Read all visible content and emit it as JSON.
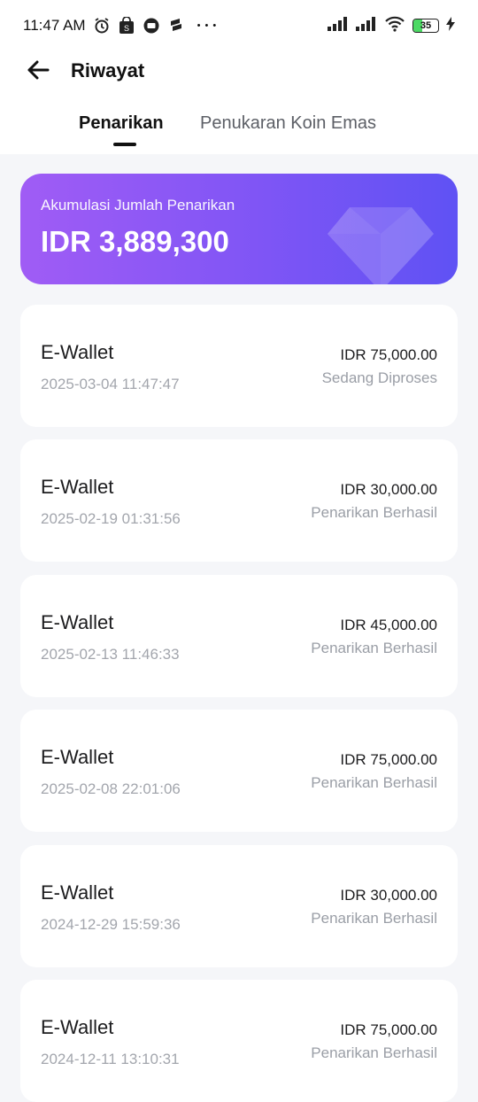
{
  "status_bar": {
    "time": "11:47 AM",
    "icons_left": [
      "alarm-icon",
      "shop-icon",
      "message-icon",
      "app-icon",
      "more-icon"
    ],
    "more_text": "• • •",
    "battery": "35",
    "icons_right": [
      "signal-icon",
      "signal-icon",
      "wifi-icon",
      "battery-icon",
      "charging-icon"
    ]
  },
  "header": {
    "title": "Riwayat",
    "back_icon": "arrow-left-icon"
  },
  "tabs": [
    {
      "label": "Penarikan",
      "active": true
    },
    {
      "label": "Penukaran Koin Emas",
      "active": false
    }
  ],
  "summary": {
    "label": "Akumulasi Jumlah Penarikan",
    "value": "IDR 3,889,300",
    "gradient_start": "#a05cf5",
    "gradient_end": "#5f52f4"
  },
  "transactions": [
    {
      "method": "E-Wallet",
      "date": "2025-03-04 11:47:47",
      "amount": "IDR 75,000.00",
      "status": "Sedang Diproses"
    },
    {
      "method": "E-Wallet",
      "date": "2025-02-19 01:31:56",
      "amount": "IDR 30,000.00",
      "status": "Penarikan Berhasil"
    },
    {
      "method": "E-Wallet",
      "date": "2025-02-13 11:46:33",
      "amount": "IDR 45,000.00",
      "status": "Penarikan Berhasil"
    },
    {
      "method": "E-Wallet",
      "date": "2025-02-08 22:01:06",
      "amount": "IDR 75,000.00",
      "status": "Penarikan Berhasil"
    },
    {
      "method": "E-Wallet",
      "date": "2024-12-29 15:59:36",
      "amount": "IDR 30,000.00",
      "status": "Penarikan Berhasil"
    },
    {
      "method": "E-Wallet",
      "date": "2024-12-11 13:10:31",
      "amount": "IDR 75,000.00",
      "status": "Penarikan Berhasil"
    }
  ]
}
